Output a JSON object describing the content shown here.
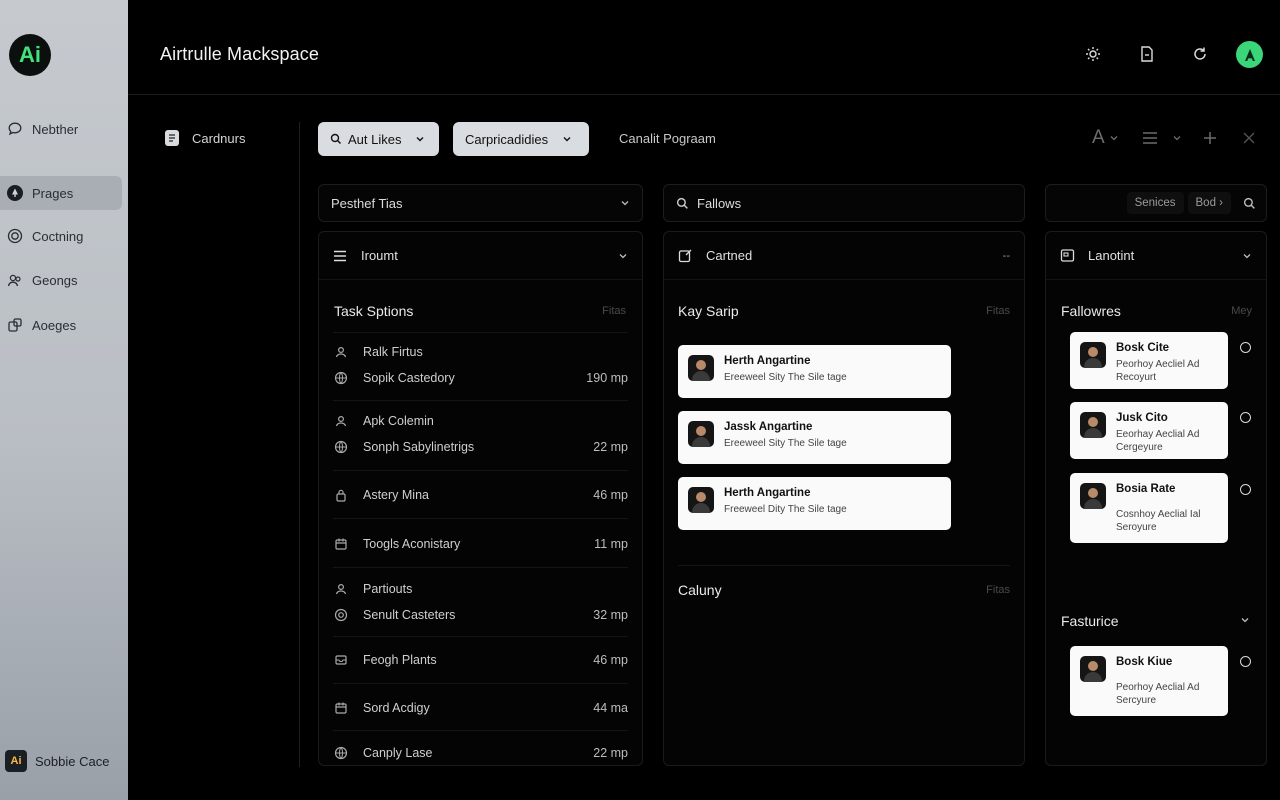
{
  "app": {
    "logo_text": "Ai",
    "title": "Airtrulle Mackspace"
  },
  "rail": {
    "items": [
      {
        "label": "Nebther",
        "icon": "chat-icon"
      },
      {
        "label": "Prages",
        "icon": "up-arrow-circle-icon",
        "active": true
      },
      {
        "label": "Coctning",
        "icon": "target-icon"
      },
      {
        "label": "Geongs",
        "icon": "users-icon"
      },
      {
        "label": "Aoeges",
        "icon": "puzzle-icon"
      }
    ],
    "footer": {
      "badge": "Ai",
      "label": "Sobbie Cace"
    }
  },
  "toolbar": {
    "nav_label": "Cardnurs",
    "pill1": "Aut Likes",
    "pill2": "Carpricadidies",
    "link": "Canalit Pograam"
  },
  "filters": {
    "left": "Pesthef Tias",
    "middle": "Fallows",
    "chip1": "Senices",
    "chip2": "Bod ›"
  },
  "panels": {
    "left": {
      "head": "Iroumt",
      "section": "Task Sptions",
      "section_meta": "Fitas",
      "rows": [
        {
          "l1": "Ralk Firtus",
          "l2": "Sopik Castedory",
          "v": "190 mp"
        },
        {
          "l1": "Apk Colemin",
          "l2": "Sonph Sabylinetrigs",
          "v": "22 mp"
        },
        {
          "l2": "Astery Mina",
          "v": "46 mp"
        },
        {
          "l2": "Toogls Aconistary",
          "v": "11 mp"
        },
        {
          "l1": "Partiouts",
          "l2": "Senult Casteters",
          "v": "32 mp"
        },
        {
          "l2": "Feogh Plants",
          "v": "46 mp"
        },
        {
          "l2": "Sord Acdigy",
          "v": "44 ma"
        },
        {
          "l2": "Canply Lase",
          "v": "22 mp"
        }
      ]
    },
    "middle": {
      "head": "Cartned",
      "head_right": "--",
      "section": "Kay Sarip",
      "section_meta": "Fitas",
      "cards": [
        {
          "name": "Herth Angartine",
          "sub": "Ereeweel Sity The Sile tage"
        },
        {
          "name": "Jassk Angartine",
          "sub": "Ereeweel Sity The Sile tage"
        },
        {
          "name": "Herth Angartine",
          "sub": "Freeweel Dity The Sile tage"
        }
      ],
      "section2": "Caluny",
      "section2_meta": "Fitas"
    },
    "right": {
      "head": "Lanotint",
      "section": "Fallowres",
      "section_meta": "Mey",
      "cards": [
        {
          "name": "Bosk Cite",
          "sub": "Peorhoy Aecliel Ad Recoyurt"
        },
        {
          "name": "Jusk Cito",
          "sub": "Eeorhay Aeclial Ad Cergeyure"
        },
        {
          "name": "Bosia Rate",
          "sub": "Cosnhoy Aeclial Ial Seroyure"
        }
      ],
      "section2": "Fasturice",
      "cards2": [
        {
          "name": "Bosk Kiue",
          "sub": "Peorhoy Aeclial Ad Sercyure"
        }
      ]
    }
  }
}
